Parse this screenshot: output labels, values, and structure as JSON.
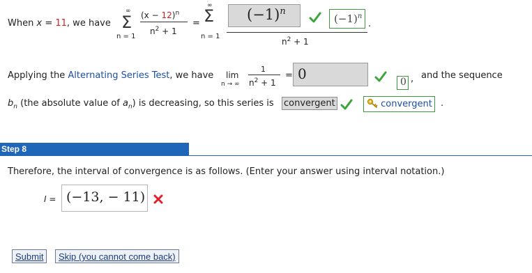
{
  "row1": {
    "when": "When",
    "x": "x",
    "eq": "=",
    "xval": "11",
    "we_have": ", we have",
    "sum_top": "∞",
    "sum_bottom": "n = 1",
    "num_open": "(x − ",
    "num_red": "12",
    "num_close": ")",
    "exp_n": "n",
    "den": "n",
    "den_sq": "2",
    "den_rest": " + 1",
    "equals": "=",
    "sum2_top": "∞",
    "sum2_bottom": "n = 1",
    "answer": "(−1)",
    "answer_exp": "n",
    "den2": "n",
    "den2_sq": "2",
    "den2_rest": " + 1",
    "side": "(−1)",
    "side_exp": "n",
    "period": "."
  },
  "row2": {
    "text1": "Applying the ",
    "link": "Alternating Series Test",
    "text2": ", we have",
    "lim": "lim",
    "lim_sub": "n → ∞",
    "num": "1",
    "den": "n",
    "den_sq": "2",
    "den_rest": " + 1",
    "eq": "=",
    "answer": "0",
    "side": "0",
    "comma": ",",
    "tail": "and the sequence"
  },
  "row3": {
    "bn": "b",
    "bn_sub": "n",
    "text1": " (the absolute value of ",
    "an": "a",
    "an_sub": "n",
    "text2": ") is decreasing, so this series is",
    "answer": "convergent",
    "side": "convergent",
    "period": "."
  },
  "step": {
    "label": "Step 8",
    "instruction": "Therefore, the interval of convergence is as follows. (Enter your answer using interval notation.)",
    "i_label": "I =",
    "answer": "(−13, − 11)"
  },
  "buttons": {
    "submit": "Submit",
    "skip": "Skip (you cannot come back)"
  },
  "colors": {
    "step_bar": "#1f66b8",
    "check": "#3aa63a",
    "cross": "#e0202a",
    "answer_box": "#d9d9d9"
  }
}
